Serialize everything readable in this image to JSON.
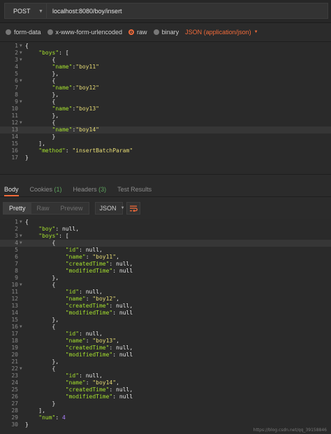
{
  "request": {
    "method": "POST",
    "url": "localhost:8080/boy/insert"
  },
  "body_types": [
    {
      "label": "form-data",
      "selected": false
    },
    {
      "label": "x-www-form-urlencoded",
      "selected": false
    },
    {
      "label": "raw",
      "selected": true
    },
    {
      "label": "binary",
      "selected": false
    }
  ],
  "content_type": "JSON (application/json)",
  "request_body_lines": [
    "{",
    "    \"boys\": [",
    "        {",
    "        \"name\":\"boy11\"",
    "        },",
    "        {",
    "        \"name\":\"boy12\"",
    "        },",
    "        {",
    "        \"name\":\"boy13\"",
    "        },",
    "        {",
    "        \"name\":\"boy14\"",
    "        }",
    "    ],",
    "    \"method\": \"insertBatchParam\"",
    "}"
  ],
  "response_tabs": [
    {
      "label": "Body",
      "count": "",
      "active": true
    },
    {
      "label": "Cookies",
      "count": "(1)",
      "active": false
    },
    {
      "label": "Headers",
      "count": "(3)",
      "active": false
    },
    {
      "label": "Test Results",
      "count": "",
      "active": false
    }
  ],
  "view_modes": [
    "Pretty",
    "Raw",
    "Preview"
  ],
  "active_view_mode": "Pretty",
  "format": "JSON",
  "response_body_lines": [
    "{",
    "    \"boy\": null,",
    "    \"boys\": [",
    "        {",
    "            \"id\": null,",
    "            \"name\": \"boy11\",",
    "            \"createdTime\": null,",
    "            \"modifiedTime\": null",
    "        },",
    "        {",
    "            \"id\": null,",
    "            \"name\": \"boy12\",",
    "            \"createdTime\": null,",
    "            \"modifiedTime\": null",
    "        },",
    "        {",
    "            \"id\": null,",
    "            \"name\": \"boy13\",",
    "            \"createdTime\": null,",
    "            \"modifiedTime\": null",
    "        },",
    "        {",
    "            \"id\": null,",
    "            \"name\": \"boy14\",",
    "            \"createdTime\": null,",
    "            \"modifiedTime\": null",
    "        }",
    "    ],",
    "    \"num\": 4",
    "}"
  ],
  "watermark": "https://blog.csdn.net/qq_39158846"
}
